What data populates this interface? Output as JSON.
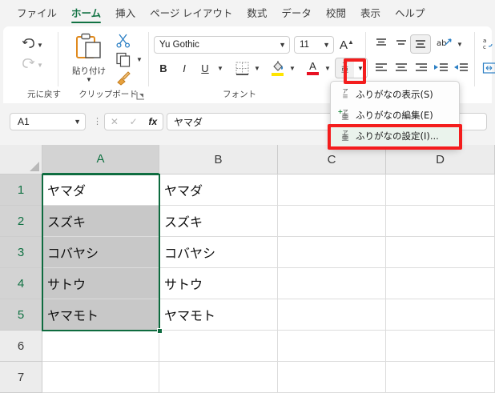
{
  "tabs": [
    {
      "label": "ファイル",
      "active": false
    },
    {
      "label": "ホーム",
      "active": true
    },
    {
      "label": "挿入",
      "active": false
    },
    {
      "label": "ページ レイアウト",
      "active": false
    },
    {
      "label": "数式",
      "active": false
    },
    {
      "label": "データ",
      "active": false
    },
    {
      "label": "校閲",
      "active": false
    },
    {
      "label": "表示",
      "active": false
    },
    {
      "label": "ヘルプ",
      "active": false
    }
  ],
  "ribbon": {
    "groups": {
      "undo_label": "元に戻す",
      "clipboard_label": "クリップボード",
      "font_label": "フォント"
    },
    "undo": {
      "undo_name": "undo-icon",
      "redo_name": "redo-icon"
    },
    "clipboard": {
      "paste_label": "貼り付け",
      "cut_name": "scissors-icon",
      "copy_name": "copy-icon",
      "format_painter_name": "format-painter-icon"
    },
    "font": {
      "font_name": "Yu Gothic",
      "font_size": "11",
      "grow_font": "A",
      "bold": "B",
      "italic": "I",
      "underline": "U",
      "border_name": "borders-icon",
      "fill_color_name": "fill-color-icon",
      "fill_color": "#ffe500",
      "font_color_name": "font-color-icon",
      "font_color": "#e81123",
      "phonetic_top": "ア",
      "phonetic_bottom": "亜"
    },
    "alignment": {
      "top_align": "align-top-icon",
      "middle_align": "align-middle-icon",
      "bottom_align": "align-bottom-icon",
      "orientation": "text-orientation-icon",
      "left_align": "align-left-icon",
      "center_align": "align-center-icon",
      "right_align": "align-right-icon",
      "decrease_indent": "decrease-indent-icon",
      "increase_indent": "increase-indent-icon",
      "wrap_text": "wrap-text-icon",
      "merge_cells": "merge-cells-icon"
    }
  },
  "formula_bar": {
    "name_box": "A1",
    "cancel": "✕",
    "enter": "✓",
    "fx": "fx",
    "content": "ヤマダ"
  },
  "grid": {
    "columns": [
      "A",
      "B",
      "C",
      "D"
    ],
    "rows": [
      "1",
      "2",
      "3",
      "4",
      "5",
      "6",
      "7"
    ],
    "cells": {
      "A": [
        "ヤマダ",
        "スズキ",
        "コバヤシ",
        "サトウ",
        "ヤマモト",
        "",
        ""
      ],
      "B": [
        "ヤマダ",
        "スズキ",
        "コバヤシ",
        "サトウ",
        "ヤマモト",
        "",
        ""
      ],
      "C": [
        "",
        "",
        "",
        "",
        "",
        "",
        ""
      ],
      "D": [
        "",
        "",
        "",
        "",
        "",
        "",
        ""
      ]
    },
    "selected_column": "A",
    "active_cell": "A1",
    "selected_range": "A1:A5"
  },
  "menu": {
    "items": [
      {
        "label": "ふりがなの表示(S)",
        "accel": "S",
        "icon": "phonetic-show-icon",
        "highlighted": false
      },
      {
        "label": "ふりがなの編集(E)",
        "accel": "E",
        "icon": "phonetic-edit-icon",
        "highlighted": false
      },
      {
        "label": "ふりがなの設定(I)...",
        "accel": "I",
        "icon": "phonetic-settings-icon",
        "highlighted": true
      }
    ]
  },
  "annotations": {
    "highlight_color": "#f41d1d",
    "dropdown_box_name": "phonetic-dropdown-highlight",
    "menu_item_box_name": "phonetic-settings-highlight"
  }
}
